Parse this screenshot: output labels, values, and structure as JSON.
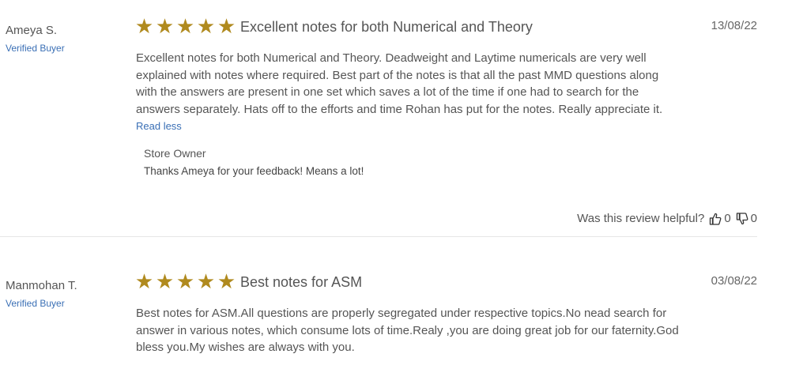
{
  "reviews": [
    {
      "author": "Ameya S.",
      "badge": "Verified Buyer",
      "rating": 5,
      "title": "Excellent notes for both Numerical and Theory",
      "date": "13/08/22",
      "body": "Excellent notes for both Numerical and Theory. Deadweight and Laytime numericals are very well explained with notes where required. Best part of the notes is that all the past MMD questions along with the answers are present in one set which saves a lot of the time if one had to search for the answers separately. Hats off to the efforts and time Rohan has put for the notes. Really appreciate it.",
      "toggle": "Read less",
      "owner_label": "Store Owner",
      "owner_reply": "Thanks Ameya for your feedback! Means a lot!",
      "helpful_label": "Was this review helpful?",
      "up_count": "0",
      "down_count": "0"
    },
    {
      "author": "Manmohan T.",
      "badge": "Verified Buyer",
      "rating": 5,
      "title": "Best notes for ASM",
      "date": "03/08/22",
      "body": "Best notes for ASM.All questions are properly segregated under respective topics.No nead search for answer in various notes, which consume lots of time.Realy ,you are doing great job for our faternity.God bless you.My wishes are always with you."
    }
  ],
  "colors": {
    "star": "#b08a1e",
    "link": "#3a6fb5"
  },
  "icons": {
    "star": "star-icon",
    "up": "thumbs-up-icon",
    "down": "thumbs-down-icon"
  }
}
